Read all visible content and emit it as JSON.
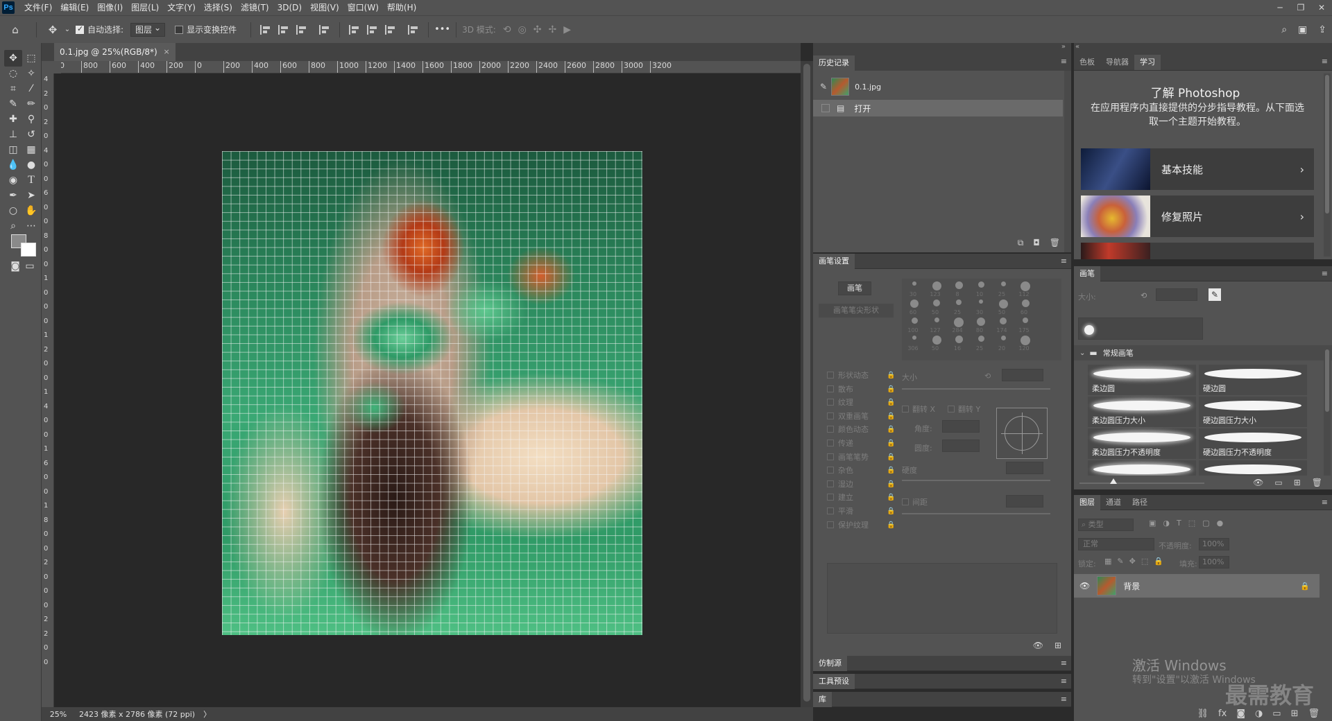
{
  "app": {
    "logo": "Ps"
  },
  "menu": [
    "文件(F)",
    "编辑(E)",
    "图像(I)",
    "图层(L)",
    "文字(Y)",
    "选择(S)",
    "滤镜(T)",
    "3D(D)",
    "视图(V)",
    "窗口(W)",
    "帮助(H)"
  ],
  "window_controls": {
    "minimize": "─",
    "restore": "❐",
    "close": "✕"
  },
  "options": {
    "auto_select_label": "自动选择:",
    "auto_select_checked": true,
    "target_value": "图层",
    "show_transform_label": "显示变换控件",
    "show_transform_checked": false,
    "more": "•••",
    "mode_3d_label": "3D 模式:"
  },
  "document": {
    "tab_title": "0.1.jpg @ 25%(RGB/8*)",
    "tab_close": "×",
    "h_ruler": [
      "00",
      "800",
      "600",
      "400",
      "200",
      "0",
      "200",
      "400",
      "600",
      "800",
      "1000",
      "1200",
      "1400",
      "1600",
      "1800",
      "2000",
      "2200",
      "2400",
      "2600",
      "2800",
      "3000",
      "3200"
    ],
    "v_ruler": [
      "4",
      "2",
      "0",
      "2",
      "0",
      "4",
      "0",
      "0",
      "6",
      "0",
      "0",
      "8",
      "0",
      "0",
      "1",
      "0",
      "0",
      "0",
      "1",
      "2",
      "0",
      "0",
      "1",
      "4",
      "0",
      "0",
      "1",
      "6",
      "0",
      "0",
      "1",
      "8",
      "0",
      "0",
      "2",
      "0",
      "0",
      "0",
      "2",
      "2",
      "0",
      "0"
    ],
    "zoom": "25%",
    "size_info": "2423 像素 x 2786 像素 (72 ppi)",
    "status_arrow": "〉"
  },
  "history_panel": {
    "tab": "历史记录",
    "snapshot_name": "0.1.jpg",
    "steps": [
      "打开"
    ]
  },
  "brush_settings_panel": {
    "tab": "画笔设置",
    "brush_button": "画笔",
    "tip_shape": "画笔笔尖形状",
    "options": [
      "形状动态",
      "散布",
      "纹理",
      "双重画笔",
      "颜色动态",
      "传递",
      "画笔笔势",
      "杂色",
      "湿边",
      "建立",
      "平滑",
      "保护纹理"
    ],
    "preset_sizes": [
      "30",
      "123",
      "8",
      "10",
      "25",
      "112",
      "60",
      "50",
      "25",
      "30",
      "50",
      "60",
      "100",
      "127",
      "284",
      "80",
      "174",
      "175",
      "306",
      "50",
      "16",
      "25",
      "20",
      "120"
    ],
    "size_label": "大小",
    "flip_x": "翻转 X",
    "flip_y": "翻转 Y",
    "angle_label": "角度:",
    "roundness_label": "圆度:",
    "hardness_label": "硬度",
    "spacing_label": "间距"
  },
  "collapsed_panels": [
    "仿制源",
    "工具预设",
    "库"
  ],
  "learn_panel": {
    "tabs": [
      "色板",
      "导航器",
      "学习"
    ],
    "active_tab": "学习",
    "title": "了解 Photoshop",
    "description": "在应用程序内直接提供的分步指导教程。从下面选取一个主题开始教程。",
    "cards": [
      "基本技能",
      "修复照片",
      ""
    ]
  },
  "brushes_panel": {
    "tab": "画笔",
    "size_label": "大小:",
    "group_name": "常规画笔",
    "brushes": [
      "柔边圆",
      "硬边圆",
      "柔边圆压力大小",
      "硬边圆压力大小",
      "柔边圆压力不透明度",
      "硬边圆压力不透明度",
      "",
      ""
    ]
  },
  "layers_panel": {
    "tabs": [
      "图层",
      "通道",
      "路径"
    ],
    "active_tab": "图层",
    "filter_placeholder": "类型",
    "blend_mode": "正常",
    "opacity_label": "不透明度:",
    "opacity_value": "100%",
    "lock_label": "锁定:",
    "fill_label": "填充:",
    "fill_value": "100%",
    "layers": [
      {
        "name": "背景",
        "visible": true,
        "locked": true
      }
    ]
  },
  "watermark": {
    "activate": "激活 Windows",
    "activate_hint": "转到\"设置\"以激活 Windows",
    "brand": "最需教育"
  }
}
